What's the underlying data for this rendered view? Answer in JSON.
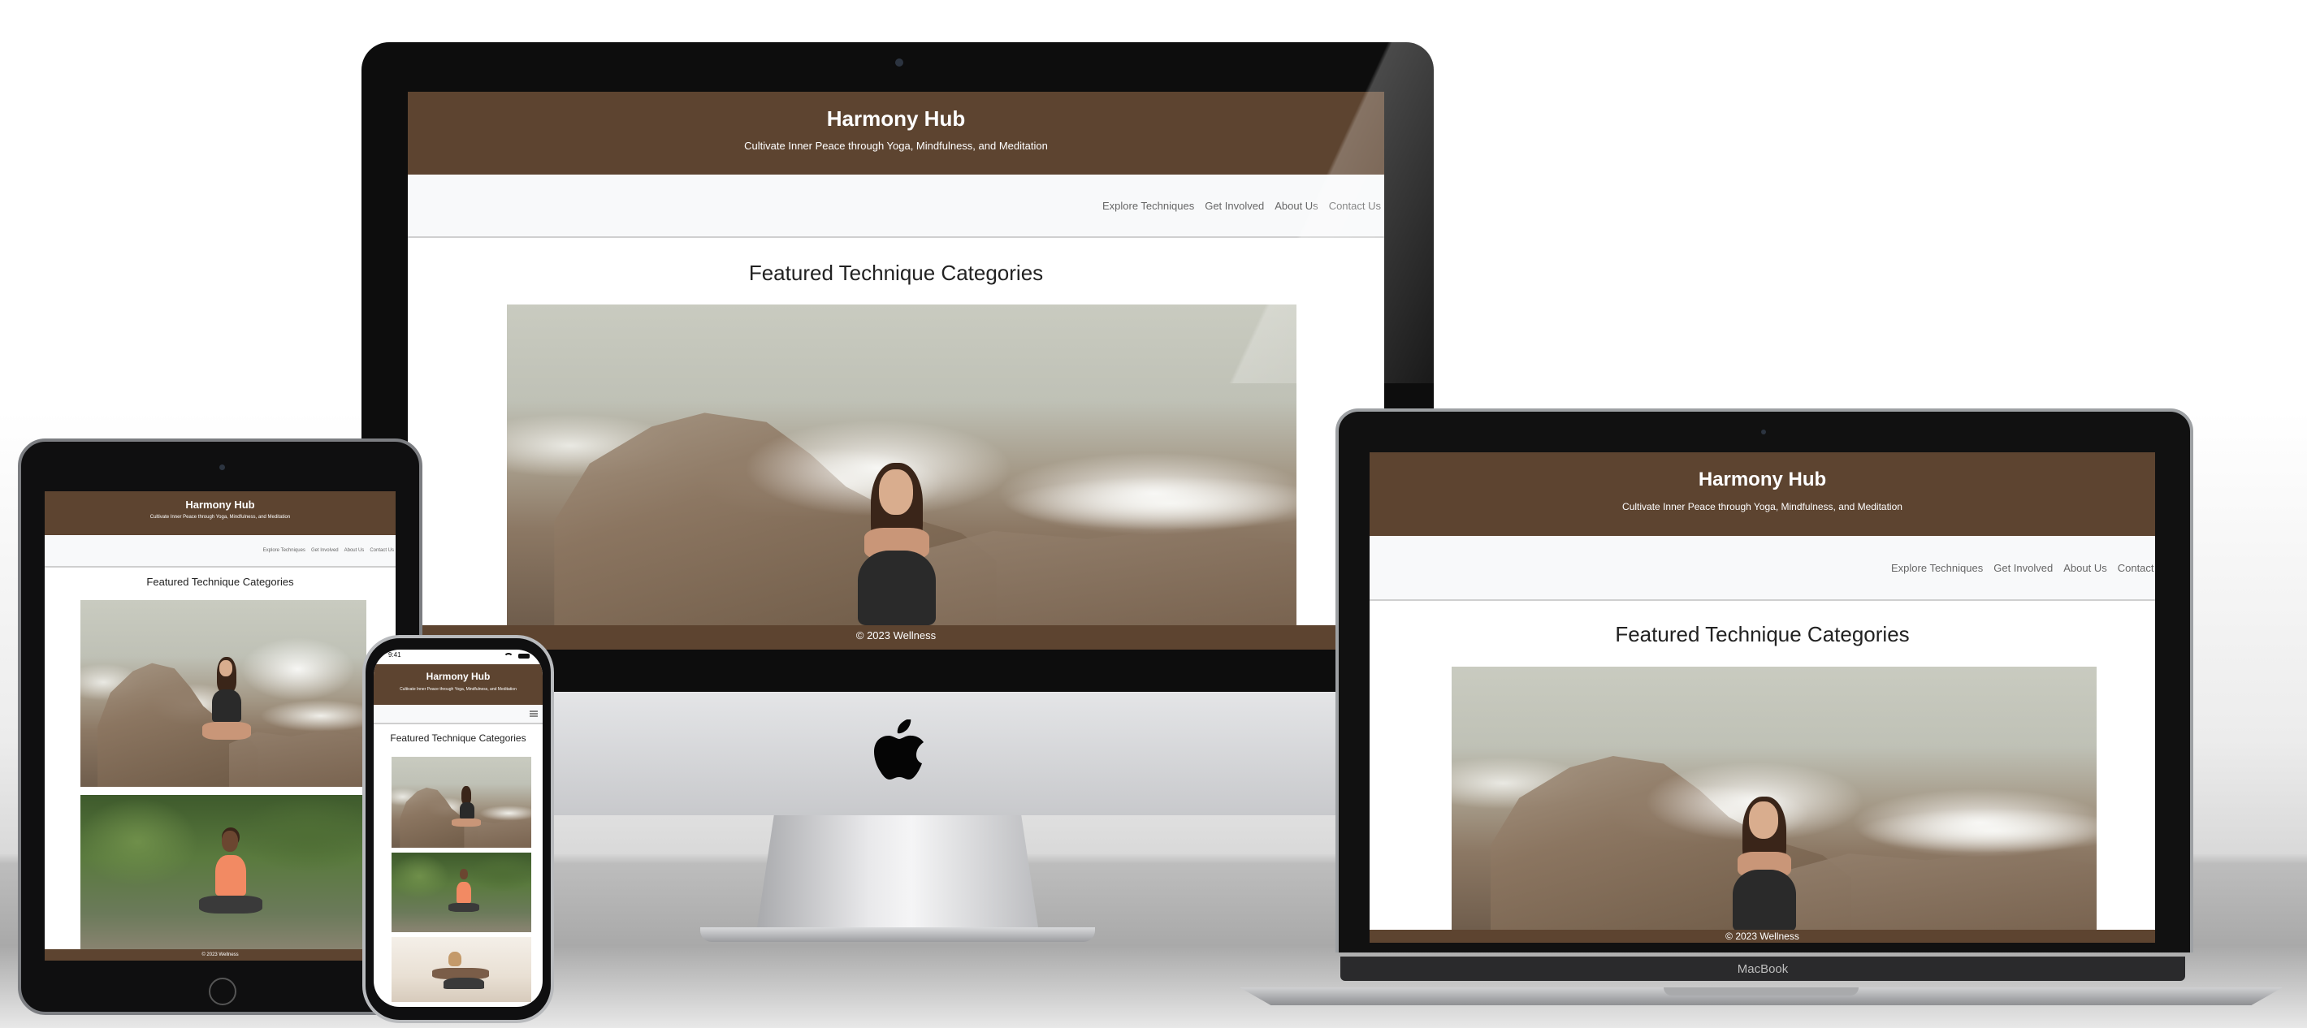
{
  "site": {
    "title": "Harmony Hub",
    "tagline": "Cultivate Inner Peace through Yoga, Mindfulness, and Meditation",
    "nav": [
      "Explore Techniques",
      "Get Involved",
      "About Us",
      "Contact Us"
    ],
    "section_title": "Featured Technique Categories",
    "footer": "© 2023 Wellness",
    "menu_icon": "hamburger-icon"
  },
  "devices": {
    "laptop_label": "MacBook",
    "phone_time": "9:41",
    "apple_logo": "apple-logo-icon"
  },
  "colors": {
    "header_brown": "#5d4430",
    "nav_bg": "#f8f9fa",
    "bezel": "#0d0d0d"
  }
}
